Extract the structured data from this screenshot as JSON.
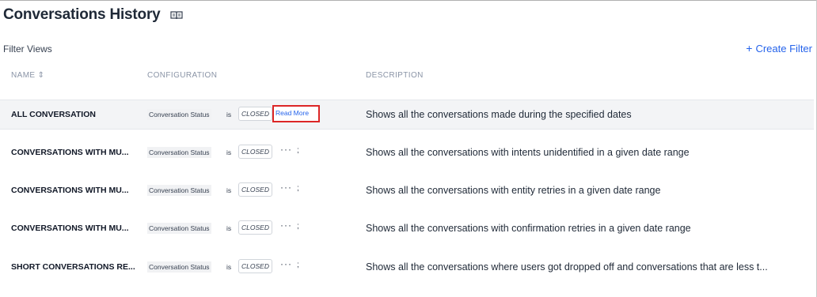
{
  "header": {
    "title": "Conversations History",
    "title_icon": "book-icon"
  },
  "filter_views_label": "Filter Views",
  "create_filter": {
    "plus": "+",
    "label": "Create Filter"
  },
  "columns": {
    "name": "NAME ⇕",
    "configuration": "CONFIGURATION",
    "description": "DESCRIPTION"
  },
  "rows": [
    {
      "name": "ALL CONVERSATION",
      "field": "Conversation Status",
      "operator": "is",
      "value": "CLOSED",
      "extra": "Read More",
      "description": "Shows all the conversations made during the specified dates"
    },
    {
      "name": "CONVERSATIONS WITH MU...",
      "field": "Conversation Status",
      "operator": "is",
      "value": "CLOSED",
      "extra": "···",
      "separator": ";",
      "description": "Shows all the conversations with intents unidentified in a given date range"
    },
    {
      "name": "CONVERSATIONS WITH MU...",
      "field": "Conversation Status",
      "operator": "is",
      "value": "CLOSED",
      "extra": "···",
      "separator": ";",
      "description": "Shows all the conversations with entity retries in a given date range"
    },
    {
      "name": "CONVERSATIONS WITH MU...",
      "field": "Conversation Status",
      "operator": "is",
      "value": "CLOSED",
      "extra": "···",
      "separator": ";",
      "description": "Shows all the conversations with confirmation retries in a given date range"
    },
    {
      "name": "SHORT CONVERSATIONS RE...",
      "field": "Conversation Status",
      "operator": "is",
      "value": "CLOSED",
      "extra": "···",
      "separator": ";",
      "description": "Shows all the conversations where users got dropped off and conversations that are less t..."
    }
  ]
}
